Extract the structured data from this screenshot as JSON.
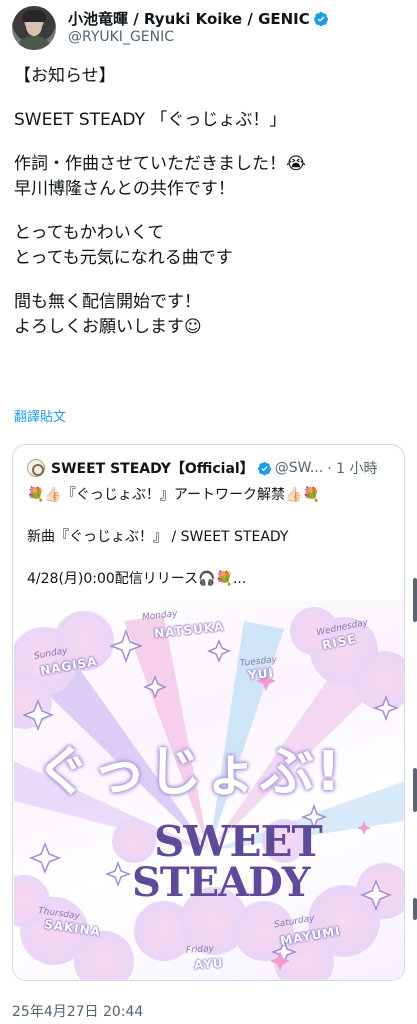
{
  "author": {
    "display_name": "小池竜暉 / Ryuki Koike / GENIC",
    "handle": "@RYUKI_GENIC",
    "verified": true
  },
  "tweet": {
    "lines": [
      "【お知らせ】",
      "",
      "SWEET STEADY 「ぐっじょぶ！」",
      "",
      "作詞・作曲させていただきました！😭",
      "早川博隆さんとの共作です！",
      "",
      "とってもかわいくて",
      "とっても元気になれる曲です",
      "",
      "間も無く配信開始です！",
      "よろしくお願いします☺"
    ],
    "translate_link": "翻譯貼文",
    "timestamp": "25年4月27日 20:44"
  },
  "quoted": {
    "name": "SWEET STEADY【Official】",
    "handle": "@SW...",
    "time": "· 1 小時",
    "lines": [
      "💐👍🏻『ぐっじょぶ！』アートワーク解禁👍🏻💐",
      "",
      "新曲『ぐっじょぶ！』 / SWEET STEADY",
      "",
      "4/28(月)0:00配信リリース🎧💐..."
    ],
    "artwork": {
      "title": "ぐっじょぶ!",
      "logo_line1": "SWEET",
      "logo_line2": "STEADY",
      "members": [
        {
          "day": "Sunday",
          "name": "NAGISA"
        },
        {
          "day": "Monday",
          "name": "NATSUKA"
        },
        {
          "day": "Tuesday",
          "name": "YUI"
        },
        {
          "day": "Wednesday",
          "name": "RISE"
        },
        {
          "day": "Thursday",
          "name": "SAKINA"
        },
        {
          "day": "Friday",
          "name": "AYU"
        },
        {
          "day": "Saturday",
          "name": "MAYUMI"
        }
      ]
    }
  },
  "colors": {
    "accent": "#1d9bf0",
    "text": "#0f1419",
    "secondary": "#536471",
    "border": "#cfd9de"
  }
}
